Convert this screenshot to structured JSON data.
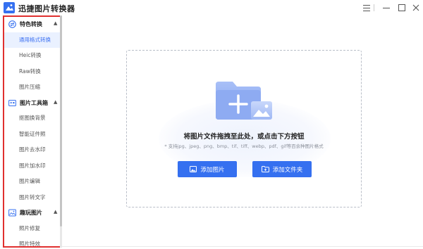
{
  "app": {
    "title": "迅捷图片转换器",
    "accent_color": "#3570f0",
    "highlight_color": "#e0302f"
  },
  "window_controls": {
    "menu_icon": "hamburger-menu-icon",
    "minimize_icon": "minimize-icon",
    "maximize_icon": "maximize-icon",
    "close_icon": "close-icon"
  },
  "sidebar": {
    "sections": [
      {
        "label": "特色转换",
        "icon": "convert-icon",
        "expanded": true,
        "items": [
          {
            "label": "通用格式转换",
            "active": true
          },
          {
            "label": "Heic转换",
            "active": false
          },
          {
            "label": "Raw转换",
            "active": false
          },
          {
            "label": "图片压缩",
            "active": false
          }
        ]
      },
      {
        "label": "图片工具箱",
        "icon": "toolbox-icon",
        "expanded": true,
        "items": [
          {
            "label": "抠图换背景",
            "active": false
          },
          {
            "label": "智能证件照",
            "active": false
          },
          {
            "label": "图片去水印",
            "active": false
          },
          {
            "label": "图片加水印",
            "active": false
          },
          {
            "label": "图片编辑",
            "active": false
          },
          {
            "label": "图片转文字",
            "active": false
          }
        ]
      },
      {
        "label": "趣玩图片",
        "icon": "gallery-icon",
        "expanded": true,
        "items": [
          {
            "label": "照片修复",
            "active": false
          },
          {
            "label": "照片特效",
            "active": false
          }
        ]
      }
    ]
  },
  "dropzone": {
    "title": "将图片文件拖拽至此处，或点击下方按钮",
    "subtitle": "* 支持jpg、jpeg、png、bmp、tif、tiff、webp、pdf、gif等百余种图片格式",
    "folder_icon": "folder-add-image-icon",
    "buttons": {
      "add_image": "添加图片",
      "add_folder": "添加文件夹"
    }
  }
}
